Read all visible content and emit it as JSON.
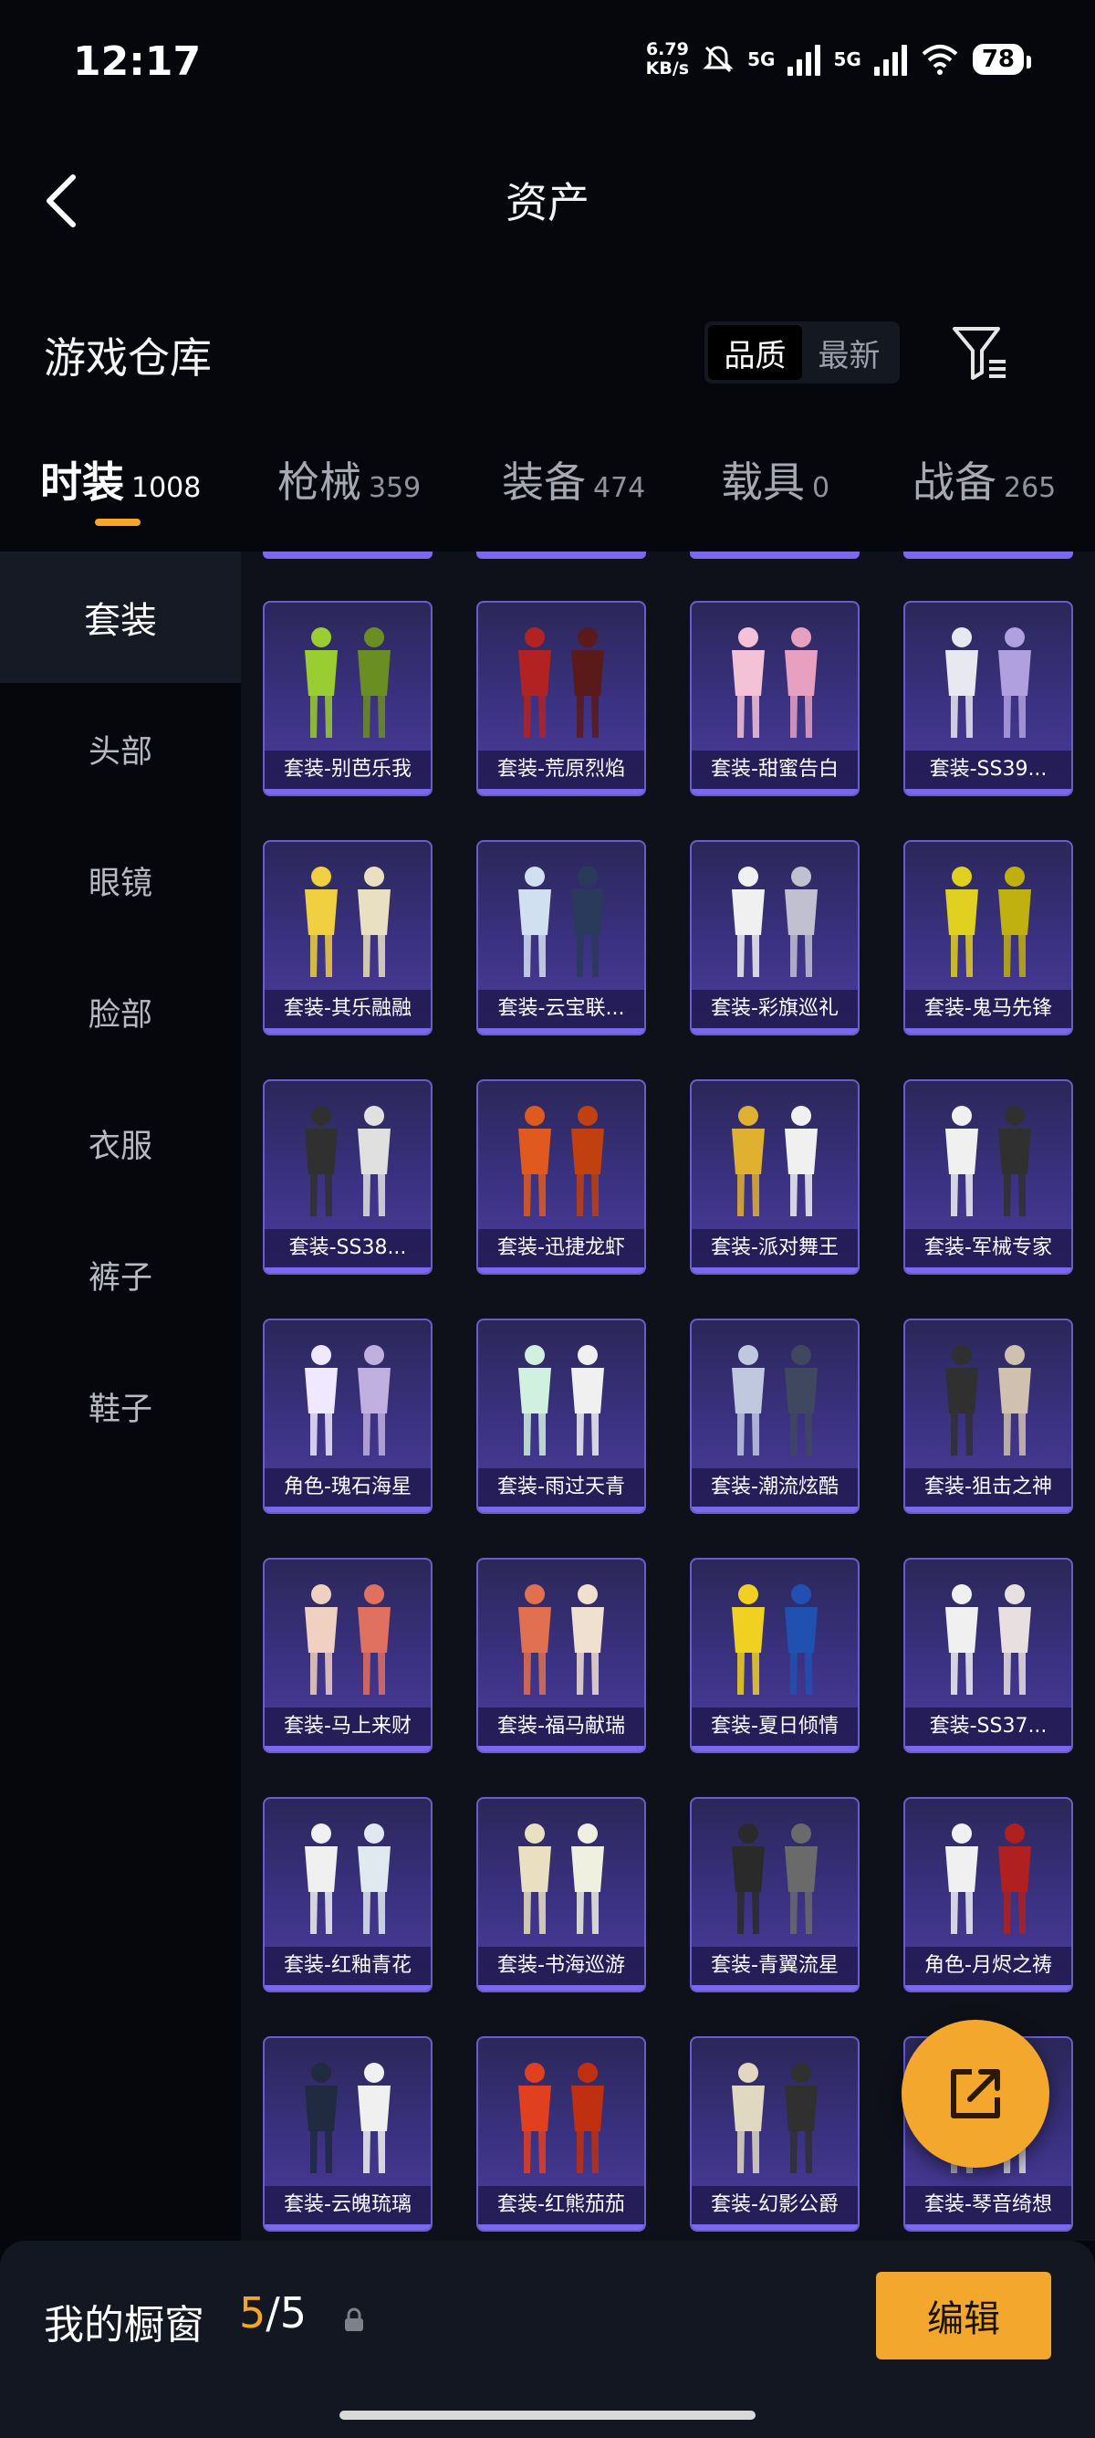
{
  "status_bar": {
    "time": "12:17",
    "net_speed_value": "6.79",
    "net_speed_unit": "KB/s",
    "signal_1": "5G",
    "signal_2": "5G",
    "battery": "78"
  },
  "header": {
    "title": "资产",
    "back_icon": "chevron-left-icon"
  },
  "warehouse": {
    "title": "游戏仓库",
    "sort_options": [
      "品质",
      "最新"
    ],
    "sort_selected": "品质",
    "filter_icon": "filter-icon"
  },
  "tabs": [
    {
      "label": "时装",
      "count": "1008",
      "active": true
    },
    {
      "label": "枪械",
      "count": "359"
    },
    {
      "label": "装备",
      "count": "474"
    },
    {
      "label": "载具",
      "count": "0"
    },
    {
      "label": "战备",
      "count": "265"
    }
  ],
  "sidebar": {
    "items": [
      {
        "label": "套装",
        "active": true
      },
      {
        "label": "头部"
      },
      {
        "label": "眼镜"
      },
      {
        "label": "脸部"
      },
      {
        "label": "衣服"
      },
      {
        "label": "裤子"
      },
      {
        "label": "鞋子"
      }
    ]
  },
  "items": [
    [
      "套装-别芭乐我",
      "套装-荒原烈焰",
      "套装-甜蜜告白",
      "套装-SS39..."
    ],
    [
      "套装-其乐融融",
      "套装-云宝联...",
      "套装-彩旗巡礼",
      "套装-鬼马先锋"
    ],
    [
      "套装-SS38...",
      "套装-迅捷龙虾",
      "套装-派对舞王",
      "套装-军械专家"
    ],
    [
      "角色-瑰石海星",
      "套装-雨过天青",
      "套装-潮流炫酷",
      "套装-狙击之神"
    ],
    [
      "套装-马上来财",
      "套装-福马献瑞",
      "套装-夏日倾情",
      "套装-SS37..."
    ],
    [
      "套装-红釉青花",
      "套装-书海巡游",
      "套装-青翼流星",
      "角色-月烬之祷"
    ],
    [
      "套装-云魄琉璃",
      "套装-红熊茄茄",
      "套装-幻影公爵",
      "套装-琴音绮想"
    ]
  ],
  "fab": {
    "icon": "share-external-icon"
  },
  "showcase": {
    "label": "我的橱窗",
    "current": "5",
    "separator": "/",
    "total": "5",
    "lock_icon": "lock-icon",
    "edit_label": "编辑"
  },
  "colors": {
    "accent": "#f5a623",
    "card_purple": "#3c3283",
    "card_border": "#6b5ccc"
  }
}
